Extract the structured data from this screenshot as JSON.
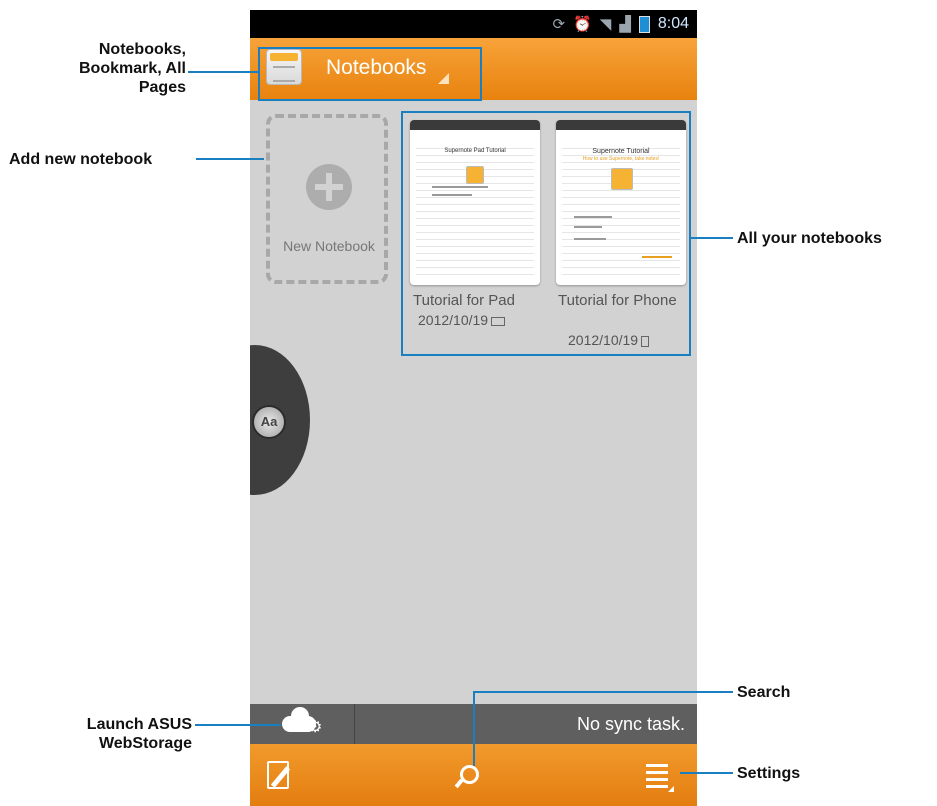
{
  "statusbar": {
    "time": "8:04"
  },
  "header": {
    "title": "Notebooks"
  },
  "new_notebook": {
    "label": "New Notebook"
  },
  "notebooks": [
    {
      "name": "Tutorial for Pad",
      "date": "2012/10/19",
      "device_icon": "pad-icon",
      "preview_title": "Supernote Pad Tutorial"
    },
    {
      "name": "Tutorial for Phone",
      "date": "2012/10/19",
      "device_icon": "phone-icon",
      "preview_title": "Supernote Tutorial",
      "preview_subtitle": "How to use Supernote, take notes!"
    }
  ],
  "side_tab": {
    "label": "Aa"
  },
  "syncbar": {
    "status": "No sync task."
  },
  "icons": {
    "cloud": "cloud-gear-icon",
    "edit": "edit-note-icon",
    "search": "search-icon",
    "settings": "menu-icon"
  },
  "callouts": {
    "notebooks_menu": "Notebooks, Bookmark, All Pages",
    "add_new": "Add new notebook",
    "all_notebooks": "All your notebooks",
    "webstorage": "Launch ASUS WebStorage",
    "search": "Search",
    "settings": "Settings"
  },
  "colors": {
    "accent": "#f29a2c",
    "callout_line": "#1a7fc0",
    "background": "#d2d2d2"
  }
}
